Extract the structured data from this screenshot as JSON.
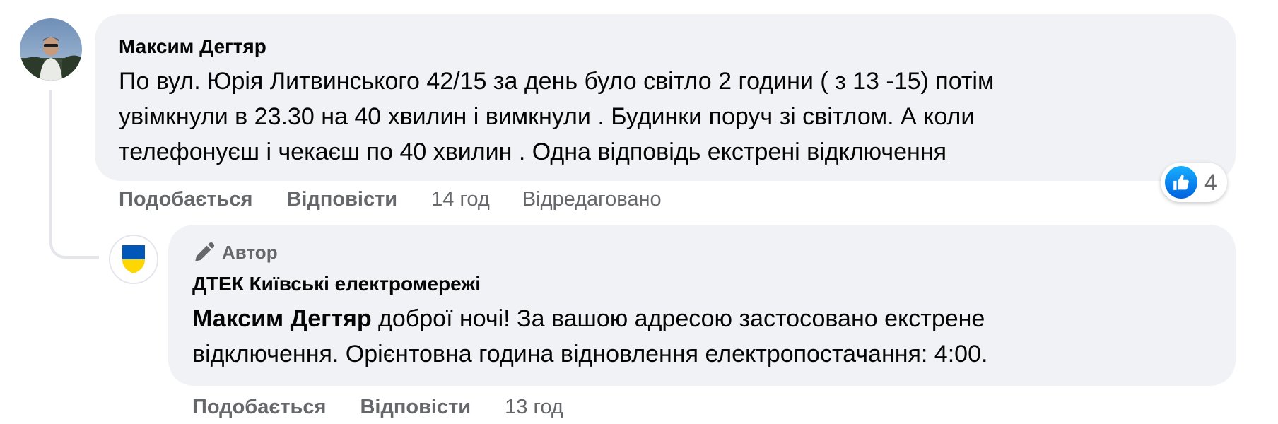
{
  "comment": {
    "author": "Максим Дегтяр",
    "text_lines": [
      "По вул. Юрія Литвинського 42/15 за день було світло 2 години ( з 13 -15) потім",
      "увімкнули в 23.30 на 40 хвилин і вимкнули . Будинки поруч зі світлом. А коли",
      "телефонуєш і чекаєш по 40 хвилин . Одна відповідь екстрені відключення"
    ],
    "actions": {
      "like": "Подобається",
      "reply": "Відповісти",
      "time": "14 год",
      "edited": "Відредаговано"
    },
    "reactions": {
      "icon": "like-icon",
      "count": "4",
      "color": "#1877f2"
    }
  },
  "reply": {
    "badge": "Автор",
    "badge_icon": "pen-icon",
    "author": "ДТЕК Київські електромережі",
    "mention": "Максим Дегтяр",
    "text_first": " доброї ночі! За вашою адресою застосовано екстрене",
    "text_second": "відключення. Орієнтовна година відновлення електропостачання: 4:00.",
    "avatar_colors": {
      "top": "#0057b8",
      "bottom": "#ffd700"
    },
    "actions": {
      "like": "Подобається",
      "reply": "Відповісти",
      "time": "13 год"
    }
  }
}
